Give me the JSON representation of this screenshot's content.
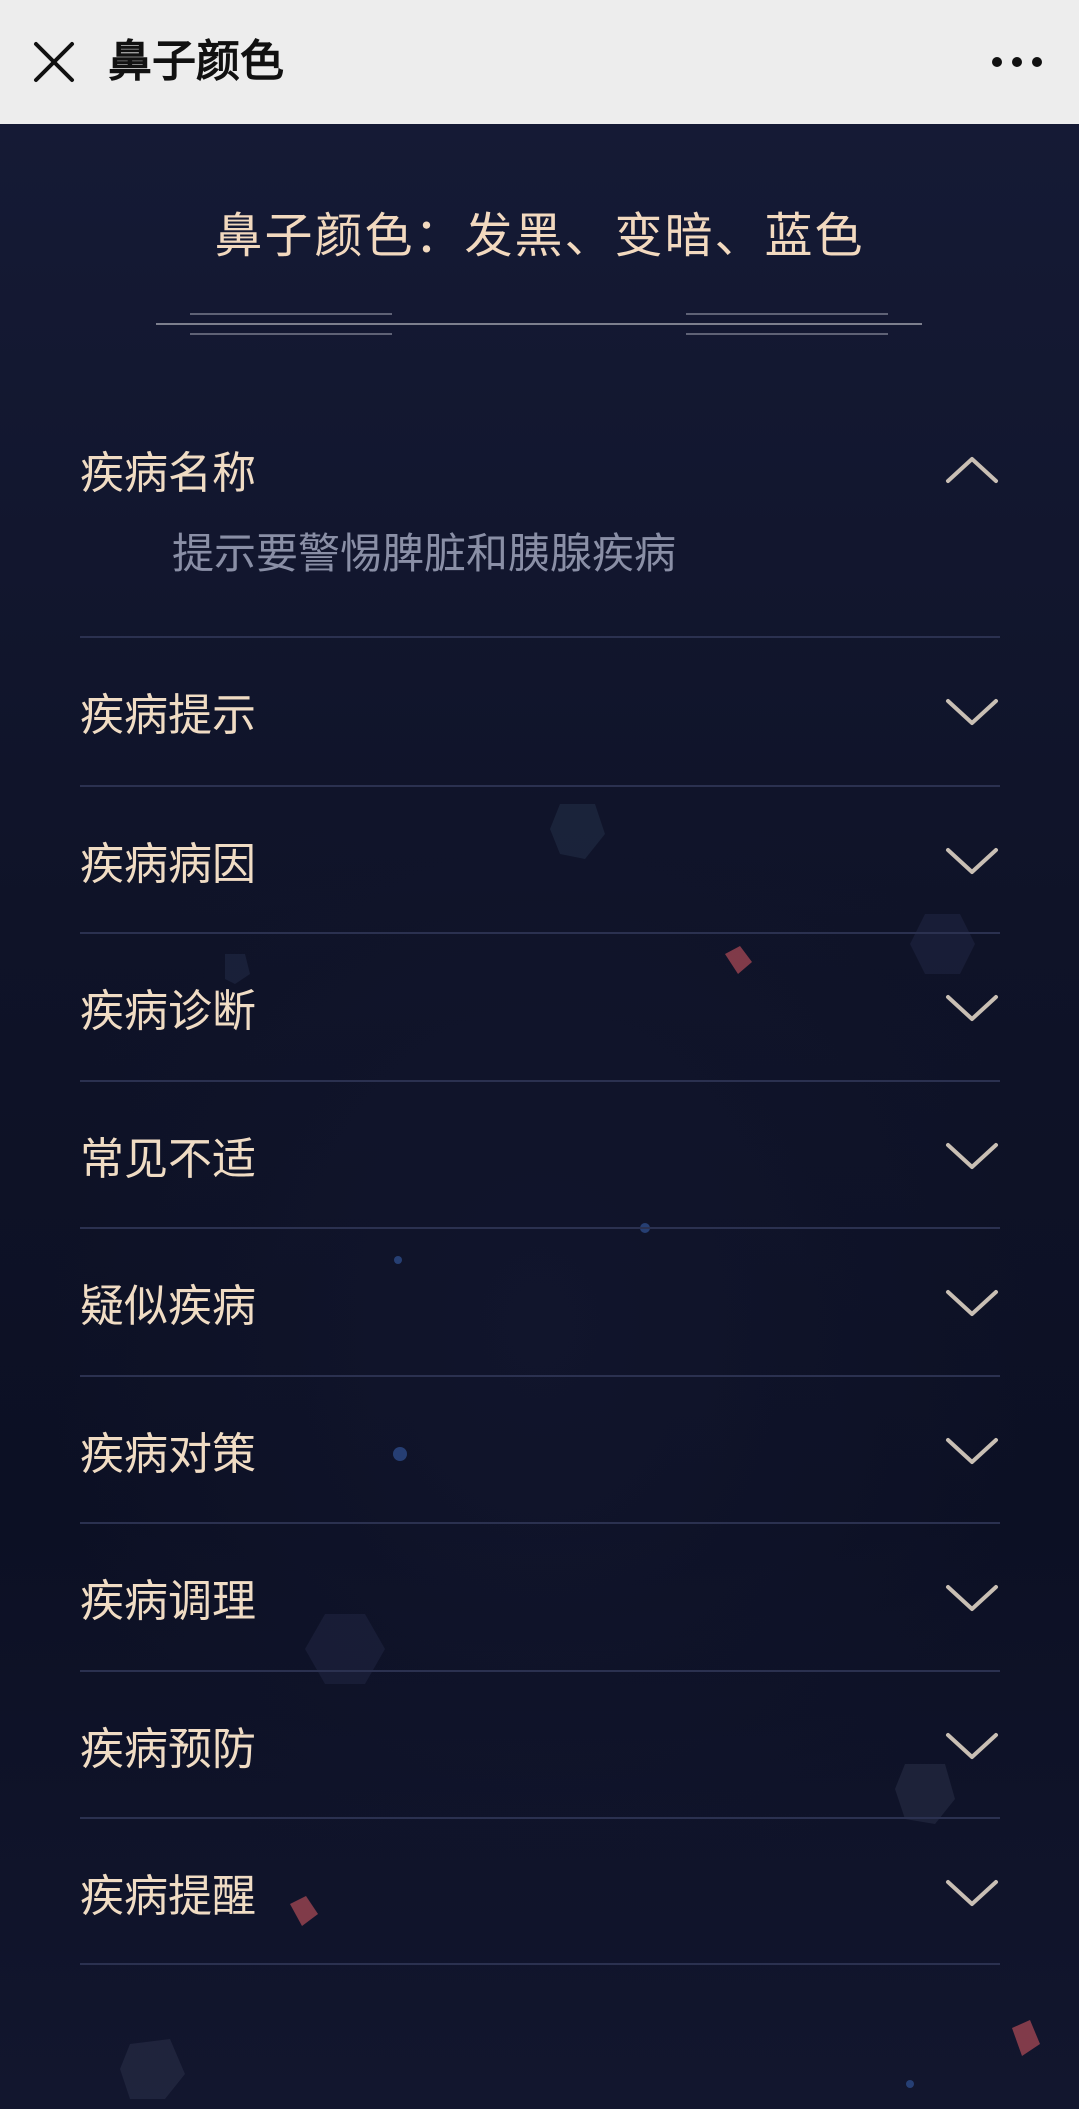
{
  "topbar": {
    "title": "鼻子颜色",
    "close_icon": "close-icon",
    "more_icon": "more-dots-icon"
  },
  "heading": "鼻子颜色：发黑、变暗、蓝色",
  "colors": {
    "page_bg": "#0e1225",
    "topbar_bg": "#ededed",
    "heading_text": "#f2d9bf",
    "item_text": "#f0dcc4",
    "body_text": "#8a8fa6",
    "divider": "#2b3150",
    "chevron": "#c9bfb4"
  },
  "accordion": {
    "items": [
      {
        "title": "疾病名称",
        "expanded": true,
        "content": "提示要警惕脾脏和胰腺疾病"
      },
      {
        "title": "疾病提示",
        "expanded": false
      },
      {
        "title": "疾病病因",
        "expanded": false
      },
      {
        "title": "疾病诊断",
        "expanded": false
      },
      {
        "title": "常见不适",
        "expanded": false
      },
      {
        "title": "疑似疾病",
        "expanded": false
      },
      {
        "title": "疾病对策",
        "expanded": false
      },
      {
        "title": "疾病调理",
        "expanded": false
      },
      {
        "title": "疾病预防",
        "expanded": false
      },
      {
        "title": "疾病提醒",
        "expanded": false
      }
    ]
  }
}
